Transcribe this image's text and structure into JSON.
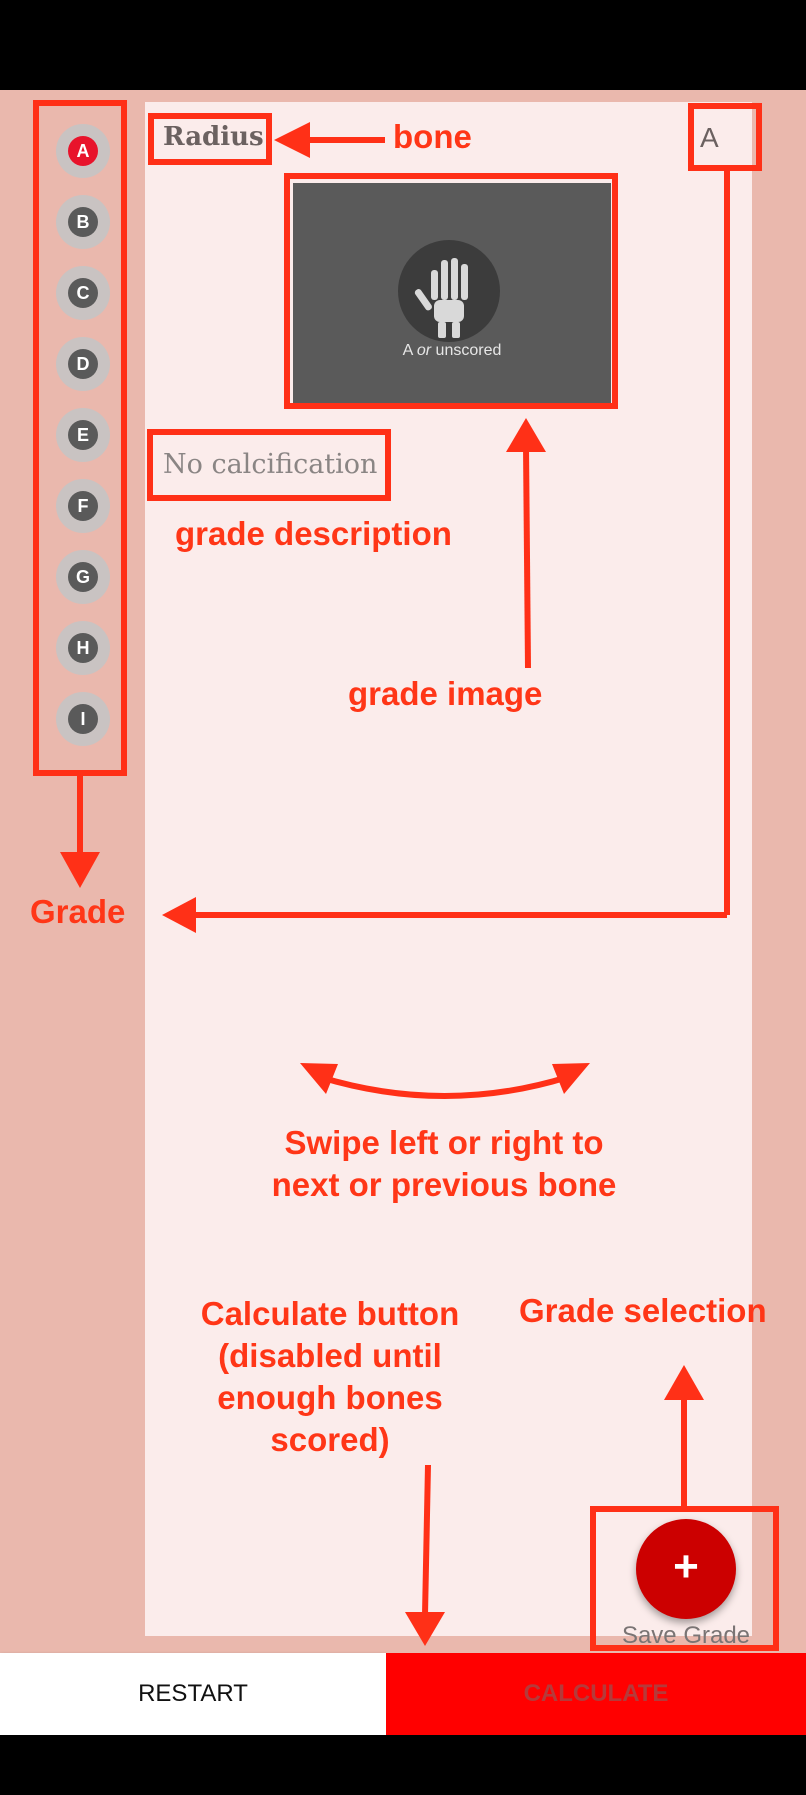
{
  "sidebar": {
    "grades": [
      "A",
      "B",
      "C",
      "D",
      "E",
      "F",
      "G",
      "H",
      "I"
    ],
    "selected": "A"
  },
  "card": {
    "bone": "Radius",
    "grade_letter": "A",
    "image_caption_a": "A",
    "image_caption_or": "or",
    "image_caption_rest": "unscored",
    "description": "No calcification"
  },
  "annotations": {
    "bone": "bone",
    "grade_description": "grade description",
    "grade_image": "grade image",
    "grade": "Grade",
    "swipe_line1": "Swipe left or right to",
    "swipe_line2": "next or previous bone",
    "calc_line1": "Calculate button",
    "calc_line2": "(disabled until",
    "calc_line3": "enough bones",
    "calc_line4": "scored)",
    "grade_selection": "Grade selection"
  },
  "fab": {
    "icon": "+",
    "label": "Save Grade"
  },
  "bottom": {
    "restart": "RESTART",
    "calculate": "CALCULATE"
  },
  "colors": {
    "accent": "#ff3617",
    "fab": "#cc0000",
    "calculate_bg": "#ff0000",
    "app_bg": "#eab8ad",
    "card_bg": "#fbeceb"
  }
}
